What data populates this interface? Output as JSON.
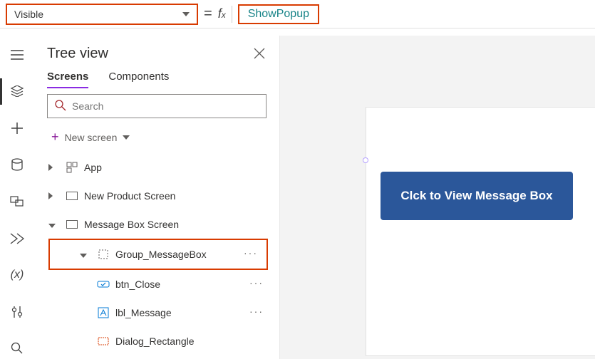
{
  "formula_bar": {
    "property": "Visible",
    "formula": "ShowPopup"
  },
  "tree": {
    "title": "Tree view",
    "tabs": {
      "screens": "Screens",
      "components": "Components"
    },
    "search_placeholder": "Search",
    "new_screen": "New screen",
    "items": {
      "app": "App",
      "new_product": "New Product Screen",
      "msg_screen": "Message Box Screen",
      "group_msgbox": "Group_MessageBox",
      "btn_close": "btn_Close",
      "lbl_message": "lbl_Message",
      "dialog_rect": "Dialog_Rectangle"
    }
  },
  "canvas": {
    "button_label": "Clck to View Message Box"
  }
}
